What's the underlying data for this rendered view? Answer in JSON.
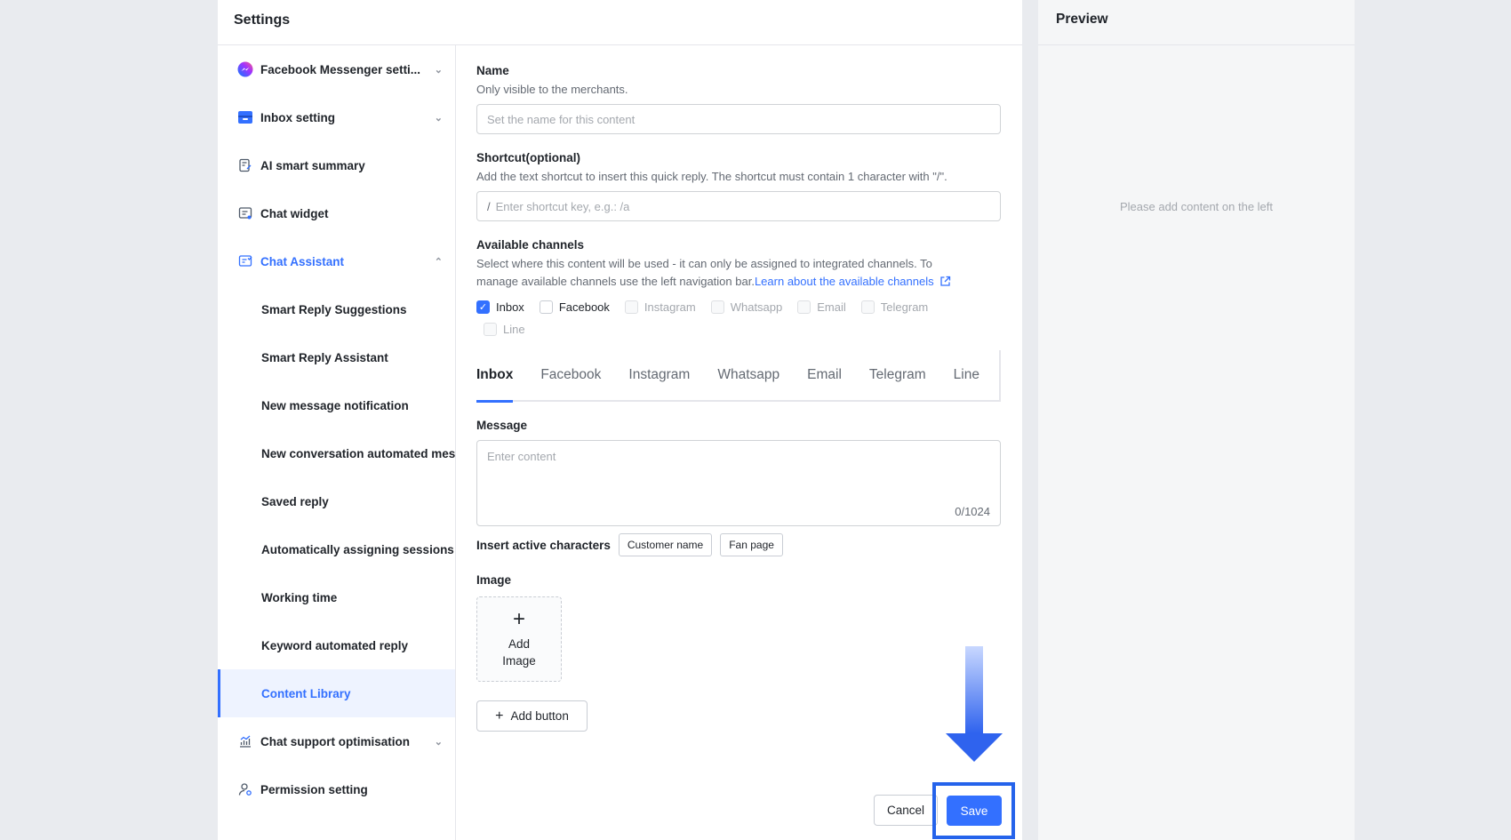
{
  "settings": {
    "title": "Settings"
  },
  "sidebar": {
    "items": [
      {
        "label": "Facebook Messenger setti..."
      },
      {
        "label": "Inbox setting"
      },
      {
        "label": "AI smart summary"
      },
      {
        "label": "Chat widget"
      },
      {
        "label": "Chat Assistant"
      },
      {
        "label": "Smart Reply Suggestions"
      },
      {
        "label": "Smart Reply Assistant"
      },
      {
        "label": "New message notification"
      },
      {
        "label": "New conversation automated mes"
      },
      {
        "label": "Saved reply"
      },
      {
        "label": "Automatically assigning sessions"
      },
      {
        "label": "Working time"
      },
      {
        "label": "Keyword automated reply"
      },
      {
        "label": "Content Library"
      },
      {
        "label": "Chat support optimisation"
      },
      {
        "label": "Permission setting"
      }
    ]
  },
  "form": {
    "name": {
      "label": "Name",
      "desc": "Only visible to the merchants.",
      "placeholder": "Set the name for this content"
    },
    "shortcut": {
      "label": "Shortcut(optional)",
      "desc": "Add the text shortcut to insert this quick reply. The shortcut must contain 1 character with \"/\".",
      "prefix": "/",
      "placeholder": "Enter shortcut key, e.g.: /a"
    },
    "channels": {
      "label": "Available channels",
      "desc_line1": "Select where this content will be used - it can only be assigned to integrated channels. To",
      "desc_line2": "manage available channels use the left navigation bar.",
      "link": "Learn about the available channels",
      "options": [
        {
          "label": "Inbox",
          "checked": true,
          "disabled": false
        },
        {
          "label": "Facebook",
          "checked": false,
          "disabled": false
        },
        {
          "label": "Instagram",
          "checked": false,
          "disabled": true
        },
        {
          "label": "Whatsapp",
          "checked": false,
          "disabled": true
        },
        {
          "label": "Email",
          "checked": false,
          "disabled": true
        },
        {
          "label": "Telegram",
          "checked": false,
          "disabled": true
        },
        {
          "label": "Line",
          "checked": false,
          "disabled": true
        }
      ]
    },
    "tabs": [
      "Inbox",
      "Facebook",
      "Instagram",
      "Whatsapp",
      "Email",
      "Telegram",
      "Line"
    ],
    "message": {
      "label": "Message",
      "placeholder": "Enter content",
      "counter": "0/1024"
    },
    "insert": {
      "label": "Insert active characters",
      "chips": [
        "Customer name",
        "Fan page"
      ]
    },
    "image": {
      "label": "Image",
      "add_line1": "Add",
      "add_line2": "Image"
    },
    "add_button": "Add button",
    "cancel": "Cancel",
    "save": "Save"
  },
  "preview": {
    "title": "Preview",
    "empty": "Please add content on the left"
  },
  "colors": {
    "accent": "#3370ff",
    "highlight": "#2563eb",
    "background": "#e9ebef"
  }
}
